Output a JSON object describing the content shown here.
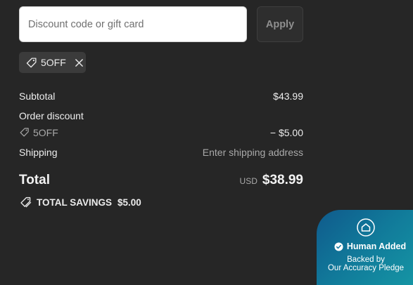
{
  "discount": {
    "placeholder": "Discount code or gift card",
    "value": "",
    "apply_label": "Apply"
  },
  "applied_code": {
    "label": "5OFF",
    "icon": "tag-icon",
    "remove_icon": "close-icon"
  },
  "summary": {
    "subtotal_label": "Subtotal",
    "subtotal_value": "$43.99",
    "order_discount_label": "Order discount",
    "discount_code": "5OFF",
    "discount_value": "− $5.00",
    "shipping_label": "Shipping",
    "shipping_value": "Enter shipping address"
  },
  "total": {
    "label": "Total",
    "currency": "USD",
    "amount": "$38.99"
  },
  "savings": {
    "label": "TOTAL SAVINGS",
    "amount": "$5.00"
  },
  "badge": {
    "headline": "Human Added",
    "line1": "Backed by",
    "line2": "Our Accuracy Pledge",
    "icon": "home-icon",
    "check_icon": "check-badge-icon"
  },
  "colors": {
    "background": "#262626",
    "chip": "#3b3b3b",
    "badge_start": "#0f5a8c",
    "badge_end": "#169aa6"
  }
}
